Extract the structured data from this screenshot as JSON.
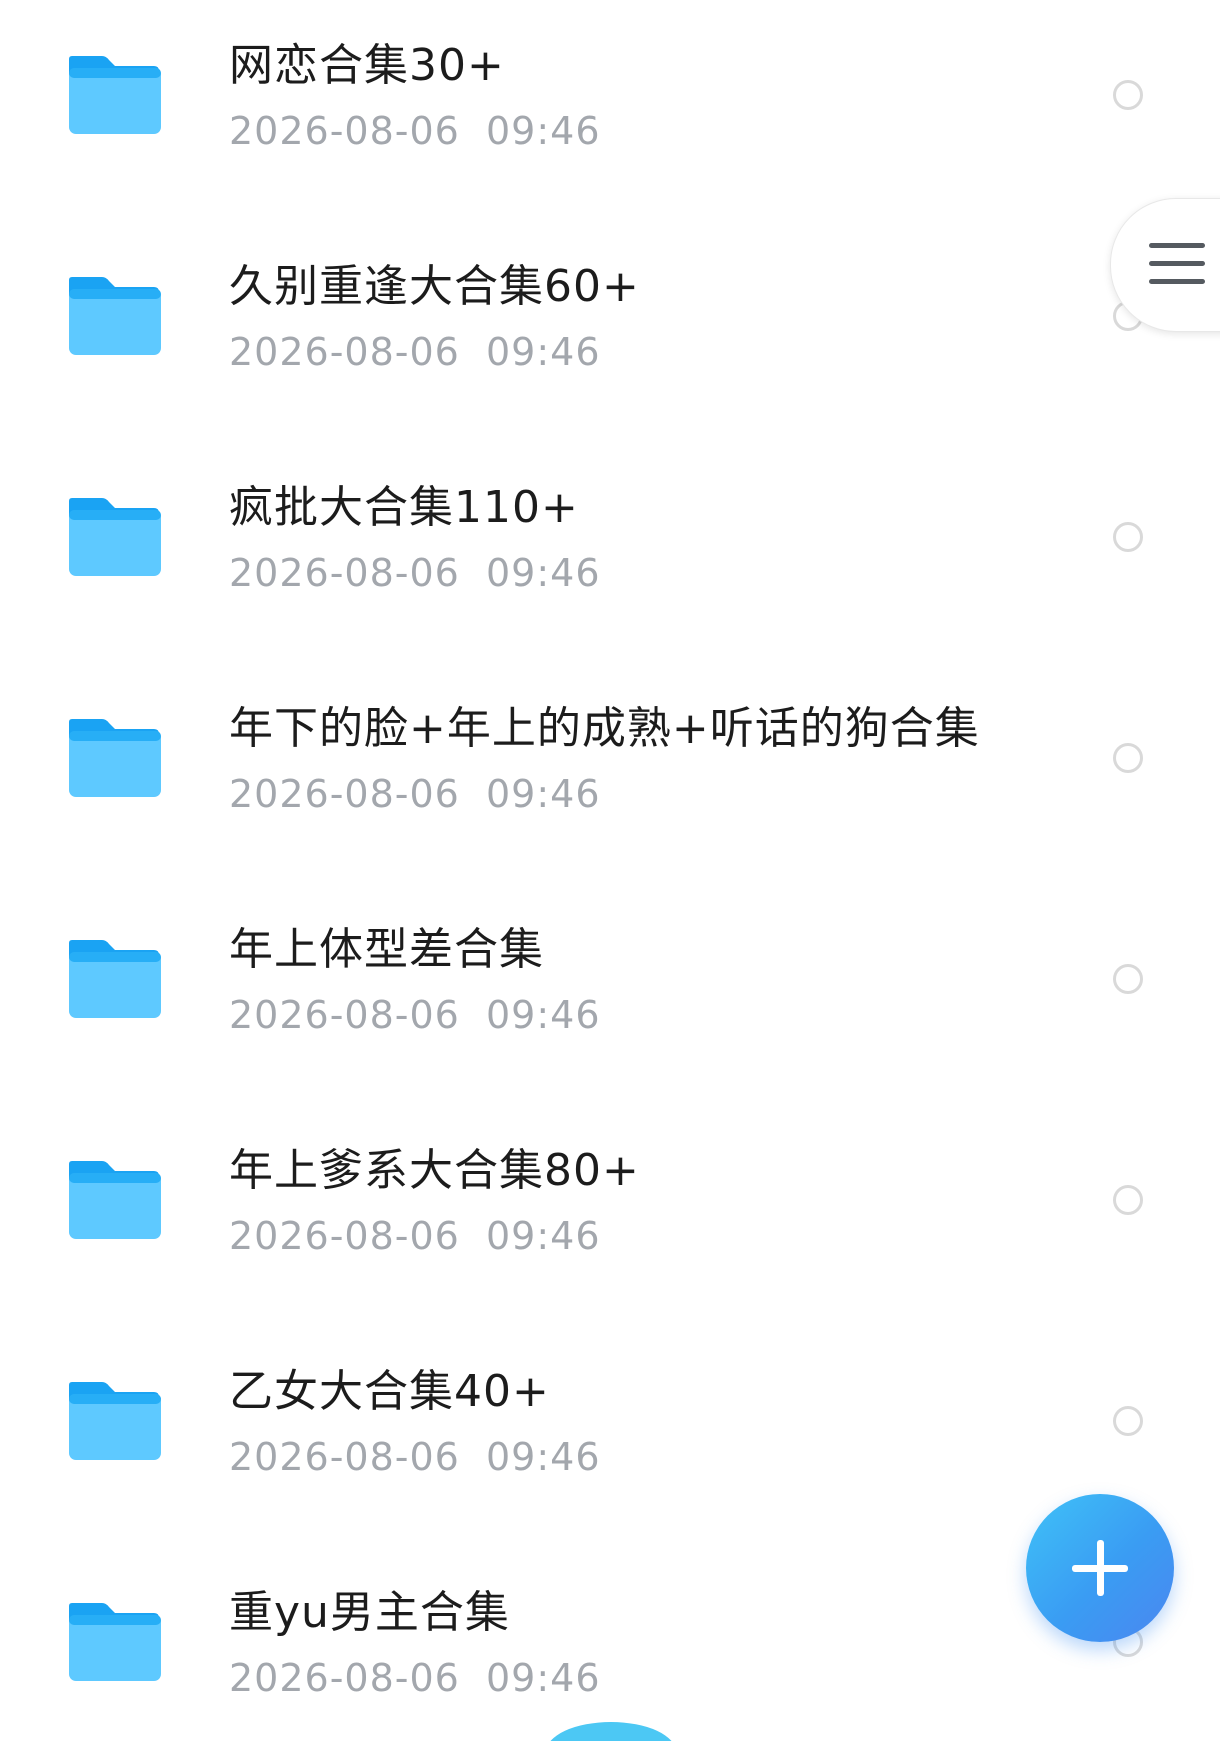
{
  "colors": {
    "folder_top": "#1aa3f3",
    "folder_body": "#5ec9ff",
    "name_text": "#1c1c1c",
    "date_text": "#a3a7ad",
    "fab_accent": "#3a9cf3"
  },
  "files": [
    {
      "name": "网恋合集30+",
      "date": "2026-08-06  09:46",
      "icon": "folder-icon"
    },
    {
      "name": "久别重逢大合集60+",
      "date": "2026-08-06  09:46",
      "icon": "folder-icon"
    },
    {
      "name": "疯批大合集110+",
      "date": "2026-08-06  09:46",
      "icon": "folder-icon"
    },
    {
      "name": "年下的脸+年上的成熟+听话的狗合集",
      "date": "2026-08-06  09:46",
      "icon": "folder-icon"
    },
    {
      "name": "年上体型差合集",
      "date": "2026-08-06  09:46",
      "icon": "folder-icon"
    },
    {
      "name": "年上爹系大合集80+",
      "date": "2026-08-06  09:46",
      "icon": "folder-icon"
    },
    {
      "name": "乙女大合集40+",
      "date": "2026-08-06  09:46",
      "icon": "folder-icon"
    },
    {
      "name": "重yu男主合集",
      "date": "2026-08-06  09:46",
      "icon": "folder-icon"
    }
  ],
  "controls": {
    "menu_icon": "hamburger-menu-icon",
    "fab_icon": "plus-icon"
  }
}
